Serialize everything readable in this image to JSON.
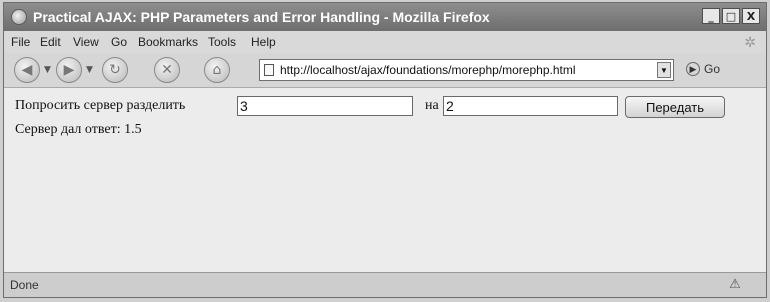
{
  "window": {
    "title": "Practical AJAX: PHP Parameters and Error Handling - Mozilla Firefox"
  },
  "window_buttons": {
    "minimize": "_",
    "maximize": "□",
    "close": "X"
  },
  "menu": [
    "File",
    "Edit",
    "View",
    "Go",
    "Bookmarks",
    "Tools",
    "Help"
  ],
  "address": {
    "url": "http://localhost/ajax/foundations/morephp/morephp.html",
    "go_label": "Go"
  },
  "form": {
    "prompt_label": "Попросить сервер разделить",
    "first_value": "3",
    "connector_label": "на",
    "second_value": "2",
    "submit_label": "Передать"
  },
  "result": {
    "text": "Сервер дал ответ: 1.5"
  },
  "status": {
    "text": "Done"
  }
}
